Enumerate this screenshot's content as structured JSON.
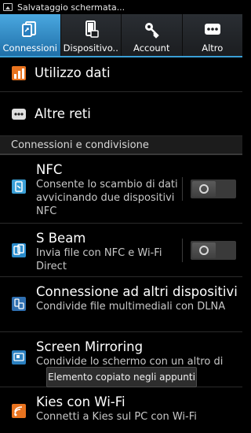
{
  "status_bar": {
    "text": "Salvataggio schermata..."
  },
  "tabs": [
    {
      "label": "Connessioni",
      "icon": "connections-icon",
      "active": true
    },
    {
      "label": "Dispositivo..",
      "icon": "device-icon",
      "active": false
    },
    {
      "label": "Account",
      "icon": "account-key-icon",
      "active": false
    },
    {
      "label": "Altro",
      "icon": "more-dots-icon",
      "active": false
    }
  ],
  "rows": {
    "data_usage": "Utilizzo dati",
    "more_networks": "Altre reti"
  },
  "section": {
    "title": "Connessioni e condivisione"
  },
  "items": [
    {
      "title": "NFC",
      "desc": "Consente lo scambio di dati avvicinando due dispositivi NFC",
      "toggle": "off"
    },
    {
      "title": "S Beam",
      "desc": "Invia file con NFC e Wi-Fi Direct",
      "toggle": "off"
    },
    {
      "title": "Connessione ad altri dispositivi",
      "desc": "Condivide file multimediali con DLNA"
    },
    {
      "title": "Screen Mirroring",
      "desc": "Condivide lo schermo con un altro di"
    },
    {
      "title": "Kies con Wi-Fi",
      "desc": "Connetti a Kies sul PC con Wi-Fi"
    }
  ],
  "toast": {
    "text": "Elemento copiato negli appunti"
  },
  "colors": {
    "accent": "#3a9fd6",
    "active_tab": "#2f8fd0"
  }
}
